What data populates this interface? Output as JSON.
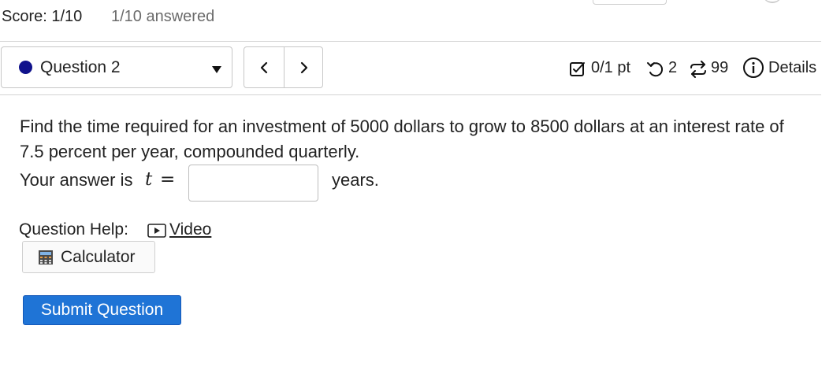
{
  "header": {
    "score": "Score: 1/10",
    "answered": "1/10 answered"
  },
  "question_nav": {
    "selected_question": "Question 2",
    "status_color": "#10128c",
    "prev_icon": "chevron-left-icon",
    "next_icon": "chevron-right-icon"
  },
  "info_bar": {
    "points": "0/1 pt",
    "retries": "2",
    "attempts": "99",
    "details": "Details"
  },
  "question": {
    "text": "Find the time required for an investment of 5000 dollars to grow to 8500 dollars at an interest rate of 7.5 percent per year, compounded quarterly.",
    "answer_prefix": "Your answer is",
    "answer_variable": "t",
    "answer_equals": "=",
    "answer_value": "",
    "answer_unit": "years."
  },
  "help": {
    "label": "Question Help:",
    "video_link": "Video",
    "calculator_label": "Calculator"
  },
  "actions": {
    "submit_label": "Submit Question",
    "submit_color": "#1f74d6"
  }
}
